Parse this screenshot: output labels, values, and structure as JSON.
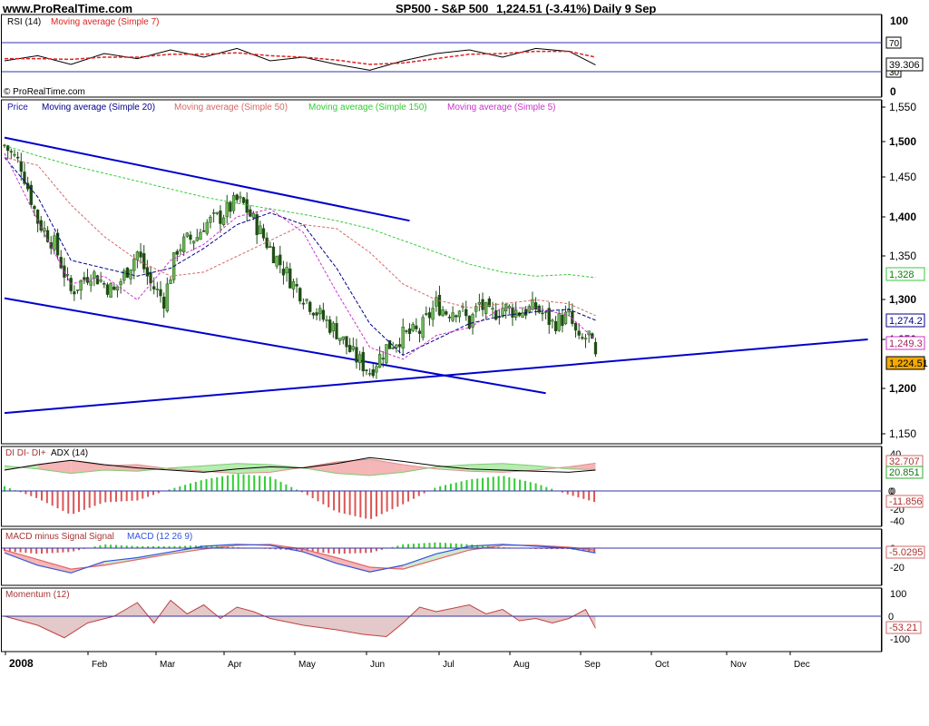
{
  "header": {
    "site": "www.ProRealTime.com",
    "symbol": "SP500 - S&P 500",
    "last": "1,224.51 (-3.41%)",
    "period": "Daily  9 Sep"
  },
  "watermark": "© ProRealTime.com",
  "colors": {
    "up": "#3c8a2e",
    "down": "#1f4d14",
    "ma20": "#00008b",
    "ma50": "#d46a6a",
    "ma150": "#33cc33",
    "ma5": "#cc33cc",
    "trend": "#0000cc",
    "rsi": "#000000",
    "rsi_ma": "#dd2222",
    "di_minus": "#f4b6b6",
    "di_plus": "#b8ecb0",
    "adx": "#000000",
    "macd": "#3355dd",
    "signal": "#e06666",
    "hist_pos": "#33cc33",
    "hist_neg": "#dd5555",
    "momentum_fill": "#e3c9c9",
    "momentum_line": "#c04040"
  },
  "chart_data": [
    {
      "type": "line",
      "panel": "rsi",
      "legend": [
        "RSI (14)",
        "Moving average (Simple 7)"
      ],
      "y_ticks": [
        "100",
        "70",
        "30",
        "0"
      ],
      "value_labels": [
        "39.306"
      ],
      "ylim": [
        0,
        100
      ],
      "x": [
        0,
        10,
        20,
        30,
        40,
        50,
        60,
        70,
        80,
        90,
        100,
        110,
        120,
        130,
        140,
        150,
        160,
        170,
        178
      ],
      "series": [
        {
          "name": "RSI (14)",
          "values": [
            45,
            52,
            40,
            55,
            48,
            60,
            50,
            62,
            45,
            50,
            40,
            32,
            45,
            55,
            60,
            50,
            62,
            58,
            39.3
          ]
        },
        {
          "name": "Moving average (Simple 7)",
          "values": [
            48,
            48,
            47,
            50,
            50,
            54,
            54,
            56,
            52,
            50,
            46,
            40,
            42,
            48,
            54,
            55,
            58,
            58,
            50
          ]
        }
      ]
    },
    {
      "type": "candlestick",
      "panel": "price",
      "legend": [
        "Price",
        "Moving average (Simple 20)",
        "Moving average (Simple 50)",
        "Moving average (Simple 150)",
        "Moving average (Simple 5)"
      ],
      "y_ticks": [
        "1,550",
        "1,500",
        "1,450",
        "1,400",
        "1,350",
        "1,300",
        "1,250",
        "1,200",
        "1,150"
      ],
      "value_labels": [
        "1,328",
        "1,274.2",
        "1,249.3",
        "1,224.51"
      ],
      "ylim": [
        1140,
        1560
      ],
      "x_ticks": [
        "2008",
        "Feb",
        "Mar",
        "Apr",
        "May",
        "Jun",
        "Jul",
        "Aug",
        "Sep",
        "Oct",
        "Nov",
        "Dec"
      ],
      "price_path": {
        "x": [
          0,
          5,
          10,
          15,
          20,
          26,
          33,
          40,
          44,
          48,
          52,
          55,
          58,
          60,
          65,
          70,
          72,
          75,
          80,
          87,
          95,
          100,
          105,
          110,
          115,
          120,
          125,
          130,
          133,
          137,
          140,
          143,
          146,
          150,
          155,
          160,
          165,
          170,
          173,
          176,
          178
        ],
        "values": [
          1495,
          1470,
          1400,
          1370,
          1310,
          1335,
          1310,
          1360,
          1320,
          1300,
          1365,
          1375,
          1380,
          1395,
          1405,
          1425,
          1420,
          1400,
          1365,
          1320,
          1280,
          1260,
          1230,
          1210,
          1240,
          1255,
          1260,
          1295,
          1285,
          1290,
          1270,
          1295,
          1280,
          1290,
          1285,
          1290,
          1270,
          1280,
          1245,
          1255,
          1224.51
        ]
      },
      "series": [
        {
          "name": "Moving average (Simple 20)",
          "x": [
            0,
            10,
            20,
            30,
            40,
            50,
            60,
            70,
            80,
            90,
            100,
            110,
            120,
            130,
            140,
            150,
            160,
            170,
            178
          ],
          "values": [
            1480,
            1430,
            1350,
            1340,
            1330,
            1340,
            1365,
            1395,
            1410,
            1395,
            1340,
            1270,
            1230,
            1250,
            1270,
            1280,
            1285,
            1288,
            1274.2
          ]
        },
        {
          "name": "Moving average (Simple 50)",
          "x": [
            0,
            10,
            20,
            30,
            40,
            50,
            60,
            70,
            80,
            90,
            100,
            110,
            120,
            130,
            140,
            150,
            160,
            170,
            178
          ],
          "values": [
            1480,
            1470,
            1420,
            1380,
            1350,
            1330,
            1335,
            1355,
            1375,
            1395,
            1390,
            1360,
            1320,
            1300,
            1290,
            1295,
            1300,
            1295,
            1280
          ]
        },
        {
          "name": "Moving average (Simple 150)",
          "x": [
            0,
            10,
            20,
            30,
            40,
            50,
            60,
            70,
            80,
            90,
            100,
            110,
            120,
            130,
            140,
            150,
            160,
            170,
            178
          ],
          "values": [
            1495,
            1482,
            1470,
            1460,
            1450,
            1440,
            1430,
            1422,
            1415,
            1408,
            1400,
            1390,
            1375,
            1360,
            1345,
            1335,
            1330,
            1332,
            1328
          ]
        },
        {
          "name": "Moving average (Simple 5)",
          "x": [
            0,
            10,
            20,
            30,
            40,
            50,
            60,
            70,
            80,
            90,
            100,
            110,
            120,
            130,
            140,
            150,
            160,
            170,
            178
          ],
          "values": [
            1485,
            1400,
            1320,
            1330,
            1300,
            1350,
            1370,
            1405,
            1415,
            1385,
            1310,
            1240,
            1225,
            1255,
            1265,
            1290,
            1290,
            1280,
            1249.3
          ]
        }
      ],
      "trendlines": [
        {
          "from": [
            0,
            1505
          ],
          "to": [
            122,
            1400
          ]
        },
        {
          "from": [
            0,
            1302
          ],
          "to": [
            163,
            1182
          ]
        },
        {
          "from": [
            0,
            1157
          ],
          "to": [
            260,
            1250
          ]
        }
      ]
    },
    {
      "type": "area",
      "panel": "dmi",
      "legend": [
        "DI",
        "DI-",
        "DI+",
        "ADX (14)"
      ],
      "y_ticks": [
        "40",
        "20",
        "0",
        "-20",
        "-40"
      ],
      "value_labels": [
        "32.707",
        "20.851",
        "0",
        "-11.856"
      ],
      "ylim": [
        -45,
        45
      ],
      "x": [
        0,
        10,
        20,
        30,
        40,
        50,
        60,
        70,
        80,
        90,
        100,
        110,
        120,
        130,
        140,
        150,
        160,
        170,
        178
      ],
      "series": [
        {
          "name": "DI-",
          "values": [
            20,
            30,
            38,
            28,
            30,
            22,
            18,
            14,
            16,
            25,
            35,
            40,
            30,
            22,
            18,
            16,
            20,
            26,
            32.7
          ]
        },
        {
          "name": "DI+",
          "values": [
            28,
            22,
            14,
            20,
            18,
            24,
            28,
            32,
            30,
            24,
            14,
            10,
            16,
            26,
            30,
            32,
            28,
            22,
            20.9
          ]
        },
        {
          "name": "ADX (14)",
          "values": [
            20,
            30,
            38,
            30,
            24,
            20,
            16,
            22,
            26,
            24,
            32,
            43,
            36,
            28,
            22,
            20,
            18,
            16,
            20
          ]
        },
        {
          "name": "DI",
          "values": [
            5,
            -8,
            -25,
            -12,
            -10,
            2,
            12,
            18,
            15,
            -2,
            -22,
            -30,
            -14,
            4,
            12,
            16,
            8,
            -4,
            -11.9
          ]
        }
      ]
    },
    {
      "type": "line",
      "panel": "macd",
      "legend": [
        "MACD minus Signal",
        "Signal",
        "MACD (12 26 9)"
      ],
      "y_ticks": [
        "0",
        "-20"
      ],
      "value_labels": [
        "-5.0295"
      ],
      "ylim": [
        -30,
        8
      ],
      "x": [
        0,
        10,
        20,
        30,
        40,
        50,
        60,
        70,
        80,
        90,
        100,
        110,
        120,
        130,
        140,
        150,
        160,
        170,
        178
      ],
      "series": [
        {
          "name": "MACD (12 26 9)",
          "values": [
            -5,
            -18,
            -26,
            -14,
            -10,
            -4,
            2,
            4,
            3,
            -4,
            -16,
            -25,
            -18,
            -6,
            2,
            4,
            2,
            0,
            -5
          ]
        },
        {
          "name": "Signal",
          "values": [
            -2,
            -12,
            -22,
            -18,
            -12,
            -6,
            -1,
            3,
            4,
            -1,
            -10,
            -20,
            -22,
            -12,
            -2,
            3,
            3,
            1,
            -2
          ]
        },
        {
          "name": "MACD minus Signal",
          "values": [
            -3,
            -6,
            -4,
            4,
            2,
            2,
            3,
            1,
            -1,
            -3,
            -6,
            -5,
            4,
            6,
            4,
            1,
            -1,
            -1,
            -5.03
          ]
        }
      ]
    },
    {
      "type": "area",
      "panel": "momentum",
      "legend": [
        "Momentum (12)"
      ],
      "y_ticks": [
        "100",
        "0",
        "-100"
      ],
      "value_labels": [
        "0",
        "-53.21"
      ],
      "ylim": [
        -115,
        115
      ],
      "x": [
        0,
        10,
        18,
        25,
        33,
        40,
        45,
        50,
        55,
        60,
        65,
        70,
        75,
        80,
        90,
        100,
        108,
        115,
        120,
        125,
        130,
        140,
        145,
        150,
        155,
        160,
        165,
        170,
        175,
        178
      ],
      "series": [
        {
          "name": "Momentum (12)",
          "values": [
            0,
            -40,
            -95,
            -30,
            0,
            60,
            -30,
            70,
            10,
            50,
            -10,
            40,
            20,
            -10,
            -40,
            -60,
            -80,
            -90,
            -30,
            40,
            20,
            50,
            10,
            30,
            -20,
            -10,
            -30,
            -10,
            30,
            -53.2
          ]
        }
      ]
    }
  ]
}
